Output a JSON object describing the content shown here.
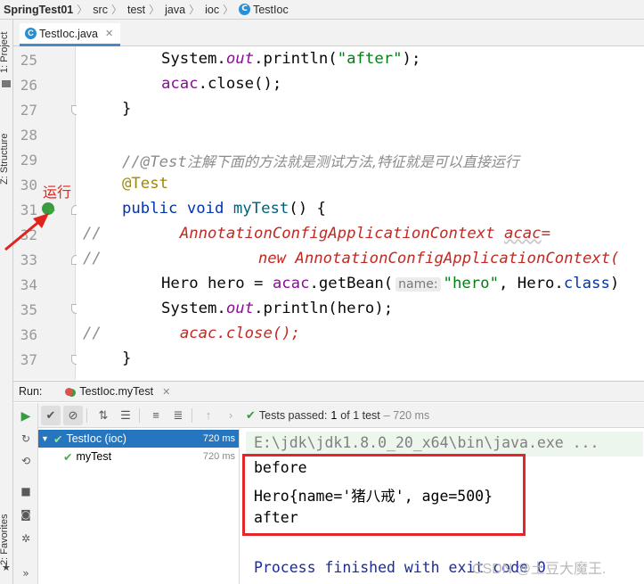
{
  "breadcrumb": {
    "project": "SpringTest01",
    "items": [
      "src",
      "test",
      "java",
      "ioc",
      "TestIoc"
    ]
  },
  "toolstrip": {
    "project_tab": "1: Project",
    "structure_tab": "Z: Structure",
    "favorites_tab": "2: Favorites"
  },
  "editor": {
    "tab_title": "TestIoc.java",
    "line_numbers": [
      "25",
      "26",
      "27",
      "28",
      "29",
      "30",
      "31",
      "32",
      "33",
      "34",
      "35",
      "36",
      "37"
    ],
    "annotation_label": "运行",
    "code": {
      "l25_a": "System.",
      "l25_b": "out",
      "l25_c": ".println(",
      "l25_d": "\"after\"",
      "l25_e": ");",
      "l26_a": "acac",
      "l26_b": ".close();",
      "l27": "}",
      "l29_a": "//@Test",
      "l29_b": "注解下面的方法就是测试方法,特征就是可以直接运行",
      "l30": "@Test",
      "l31_a": "public void ",
      "l31_b": "myTest",
      "l31_c": "() {",
      "l32_a": "//",
      "l32_b": "AnnotationConfigApplicationContext ",
      "l32_c": "acac",
      "l32_d": "=",
      "l33_a": "//",
      "l33_b": "new AnnotationConfigApplicationContext(",
      "l34_a": "Hero hero = ",
      "l34_b": "acac",
      "l34_c": ".getBean(",
      "l34_hint": "name:",
      "l34_d": "\"hero\"",
      "l34_e": ", Hero.",
      "l34_f": "class",
      "l34_g": ")",
      "l35_a": "System.",
      "l35_b": "out",
      "l35_c": ".println(hero);",
      "l36_a": "//",
      "l36_b": "acac.close();",
      "l37": "}"
    }
  },
  "run_panel": {
    "label": "Run:",
    "tab_title": "TestIoc.myTest",
    "status": {
      "passed_label": "Tests passed:",
      "passed_value": "1",
      "count_text": "of 1 test",
      "time_text": "– 720 ms"
    },
    "tree": [
      {
        "name": "TestIoc (ioc)",
        "time": "720 ms",
        "selected": true
      },
      {
        "name": "myTest",
        "time": "720 ms",
        "selected": false
      }
    ],
    "console": {
      "command": "E:\\jdk\\jdk1.8.0_20_x64\\bin\\java.exe ...",
      "lines": [
        "before",
        "Hero{name='猪八戒', age=500}",
        "after"
      ],
      "exit": "Process finished with exit code 0"
    }
  },
  "watermark": "CSDN @土豆大魔王.",
  "colors": {
    "keyword": "#0033b3",
    "string": "#067d17",
    "annotation": "#9e880d",
    "comment": "#8c8c8c",
    "selection": "#2675bf",
    "highlight_box": "#e3262a"
  }
}
